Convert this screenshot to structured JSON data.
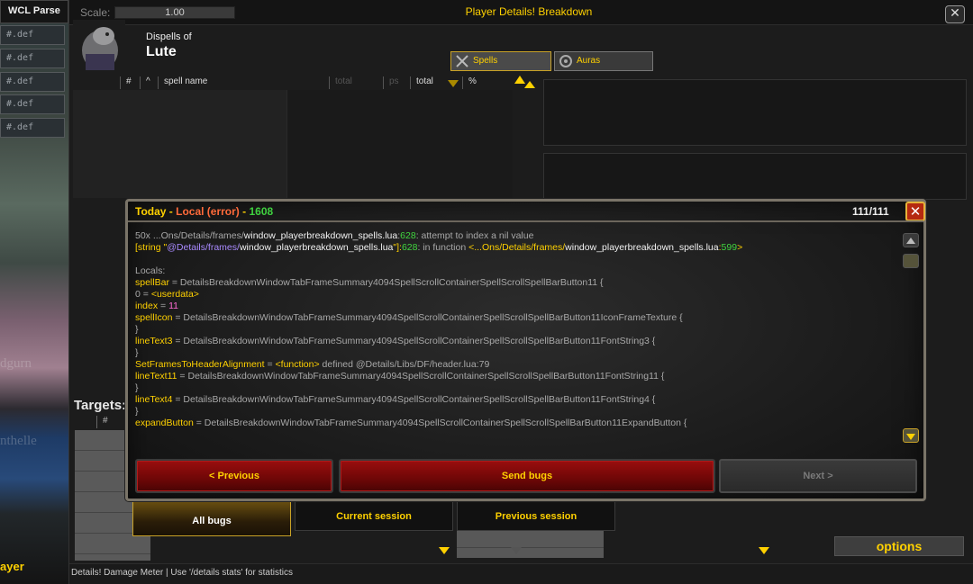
{
  "wcl": {
    "title": "WCL Parse",
    "def_rows": [
      "#.def",
      "#.def",
      "#.def",
      "#.def",
      "#.def"
    ],
    "ghost_text": [
      "dgurn",
      "nthelle"
    ],
    "targets_label": "Targets:",
    "player_label": "ayer"
  },
  "breakdown": {
    "scale_label": "Scale:",
    "scale_value": "1.00",
    "title": "Player Details! Breakdown",
    "close_glyph": "✕",
    "dispels_label": "Dispells of",
    "player_name": "Lute",
    "tabs": [
      {
        "label": "Spells",
        "icon": "crossed-swords-icon",
        "active": true
      },
      {
        "label": "Auras",
        "icon": "aura-icon",
        "active": false
      }
    ],
    "columns": [
      "#",
      "^",
      "spell name",
      "total",
      "%"
    ],
    "faded_columns": [
      "total",
      "ps"
    ],
    "lower_columns": [
      "#"
    ],
    "session_tabs": [
      "All bugs",
      "Current session",
      "Previous session"
    ],
    "options_label": "options",
    "status_text": "Details! Damage Meter | Use '/details stats' for statistics"
  },
  "error_dialog": {
    "title_today": "Today",
    "title_sep1": " - ",
    "title_local": "Local (error)",
    "title_sep2": " - ",
    "title_count": "1608",
    "counter": "111/111",
    "close_glyph": "✕",
    "lines": {
      "l1_a": "50x ...Ons/Details/frames/",
      "l1_b": "window_playerbreakdown_spells.lua",
      "l1_c": ":",
      "l1_d": "628",
      "l1_e": ": attempt to index a nil value",
      "l2_a": "[string \"",
      "l2_b": "@Details/frames/",
      "l2_c": "window_playerbreakdown_spells.lua",
      "l2_d": "\"]:",
      "l2_e": "628",
      "l2_f": ": in function ",
      "l2_g": "<...Ons/Details/frames/",
      "l2_h": "window_playerbreakdown_spells.lua",
      "l2_i": ":",
      "l2_j": "599",
      "l2_k": ">",
      "locals": "Locals:",
      "v1_name": "spellBar",
      "v1_val": " = DetailsBreakdownWindowTabFrameSummary4094SpellScrollContainerSpellScrollSpellBarButton11 {",
      "v2_name": " 0",
      "v2_eq": " = ",
      "v2_val": "<userdata>",
      "v3_name": " index",
      "v3_eq": " = ",
      "v3_val": "11",
      "v4_name": " spellIcon",
      "v4_val": " = DetailsBreakdownWindowTabFrameSummary4094SpellScrollContainerSpellScrollSpellBarButton11IconFrameTexture {",
      "close1": " }",
      "v5_name": " lineText3",
      "v5_val": " = DetailsBreakdownWindowTabFrameSummary4094SpellScrollContainerSpellScrollSpellBarButton11FontString3 {",
      "close2": " }",
      "v6_name": " SetFramesToHeaderAlignment",
      "v6_eq": " = ",
      "v6_val": "<function>",
      "v6_rest": " defined @Details/Libs/DF/header.lua:79",
      "v7_name": " lineText11",
      "v7_val": " = DetailsBreakdownWindowTabFrameSummary4094SpellScrollContainerSpellScrollSpellBarButton11FontString11 {",
      "close3": " }",
      "v8_name": " lineText4",
      "v8_val": " = DetailsBreakdownWindowTabFrameSummary4094SpellScrollContainerSpellScrollSpellBarButton11FontString4 {",
      "close4": " }",
      "v9_name": " expandButton",
      "v9_val": " = DetailsBreakdownWindowTabFrameSummary4094SpellScrollContainerSpellScrollSpellBarButton11ExpandButton {"
    },
    "buttons": {
      "previous": "< Previous",
      "send": "Send bugs",
      "next": "Next >"
    }
  },
  "colors": {
    "accent_gold": "#ffd100",
    "error_orange": "#ff6a3a",
    "success_green": "#41d63f",
    "button_red": "#8a0b0b"
  }
}
